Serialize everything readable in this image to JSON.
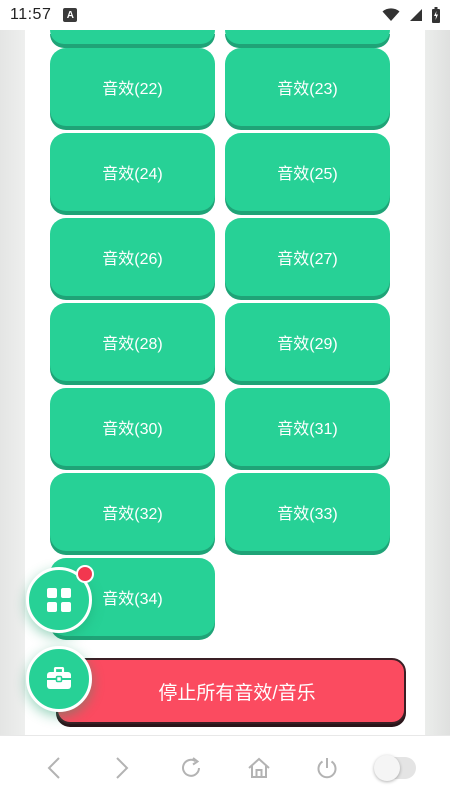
{
  "status_bar": {
    "time": "11:57",
    "notification_icon": "A",
    "icons": [
      "wifi-icon",
      "signal-icon",
      "battery-icon"
    ]
  },
  "sound_effects": {
    "partial_top": [
      "",
      ""
    ],
    "buttons": [
      "音效(22)",
      "音效(23)",
      "音效(24)",
      "音效(25)",
      "音效(26)",
      "音效(27)",
      "音效(28)",
      "音效(29)",
      "音效(30)",
      "音效(31)",
      "音效(32)",
      "音效(33)",
      "音效(34)"
    ]
  },
  "stop_all": {
    "label": "停止所有音效/音乐"
  },
  "fabs": {
    "grid_icon": "grid-icon",
    "toolbox_icon": "toolbox-icon",
    "badge_color": "#f2374f"
  },
  "nav": {
    "items": [
      "back-icon",
      "forward-icon",
      "refresh-icon",
      "home-icon",
      "power-icon",
      "toggle-switch"
    ]
  },
  "colors": {
    "accent": "#27d196",
    "danger": "#fb4b60"
  }
}
